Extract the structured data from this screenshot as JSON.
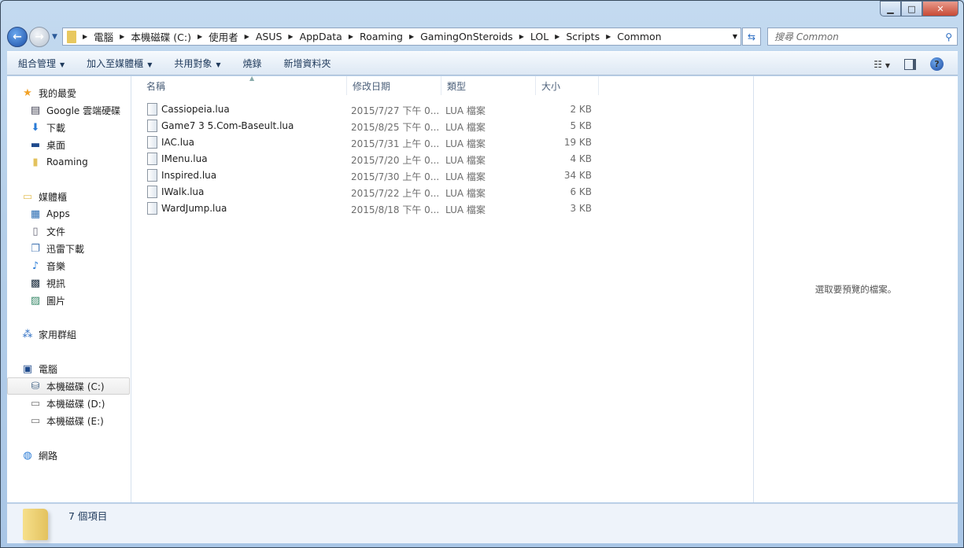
{
  "address": {
    "crumbs": [
      "電腦",
      "本機磁碟 (C:)",
      "使用者",
      "ASUS",
      "AppData",
      "Roaming",
      "GamingOnSteroids",
      "LOL",
      "Scripts",
      "Common"
    ]
  },
  "search": {
    "placeholder": "搜尋 Common"
  },
  "toolbar": {
    "organize": "組合管理",
    "add_library": "加入至媒體櫃",
    "share": "共用對象",
    "burn": "燒錄",
    "new_folder": "新增資料夾"
  },
  "sidebar": {
    "favorites": {
      "label": "我的最愛",
      "items": [
        "Google 雲端硬碟",
        "下載",
        "桌面",
        "Roaming"
      ]
    },
    "libraries": {
      "label": "媒體櫃",
      "items": [
        "Apps",
        "文件",
        "迅雷下載",
        "音樂",
        "視訊",
        "圖片"
      ]
    },
    "homegroup": "家用群組",
    "computer": {
      "label": "電腦",
      "items": [
        "本機磁碟 (C:)",
        "本機磁碟 (D:)",
        "本機磁碟 (E:)"
      ]
    },
    "network": "網路"
  },
  "columns": {
    "name": "名稱",
    "date": "修改日期",
    "type": "類型",
    "size": "大小"
  },
  "files": [
    {
      "name": "Cassiopeia.lua",
      "date": "2015/7/27 下午 0...",
      "type": "LUA 檔案",
      "size": "2 KB"
    },
    {
      "name": "Game7 3 5.Com-Baseult.lua",
      "date": "2015/8/25 下午 0...",
      "type": "LUA 檔案",
      "size": "5 KB"
    },
    {
      "name": "IAC.lua",
      "date": "2015/7/31 上午 0...",
      "type": "LUA 檔案",
      "size": "19 KB"
    },
    {
      "name": "IMenu.lua",
      "date": "2015/7/20 上午 0...",
      "type": "LUA 檔案",
      "size": "4 KB"
    },
    {
      "name": "Inspired.lua",
      "date": "2015/7/30 上午 0...",
      "type": "LUA 檔案",
      "size": "34 KB"
    },
    {
      "name": "IWalk.lua",
      "date": "2015/7/22 上午 0...",
      "type": "LUA 檔案",
      "size": "6 KB"
    },
    {
      "name": "WardJump.lua",
      "date": "2015/8/18 下午 0...",
      "type": "LUA 檔案",
      "size": "3 KB"
    }
  ],
  "preview": {
    "message": "選取要預覽的檔案。"
  },
  "status": {
    "count": "7 個項目"
  }
}
